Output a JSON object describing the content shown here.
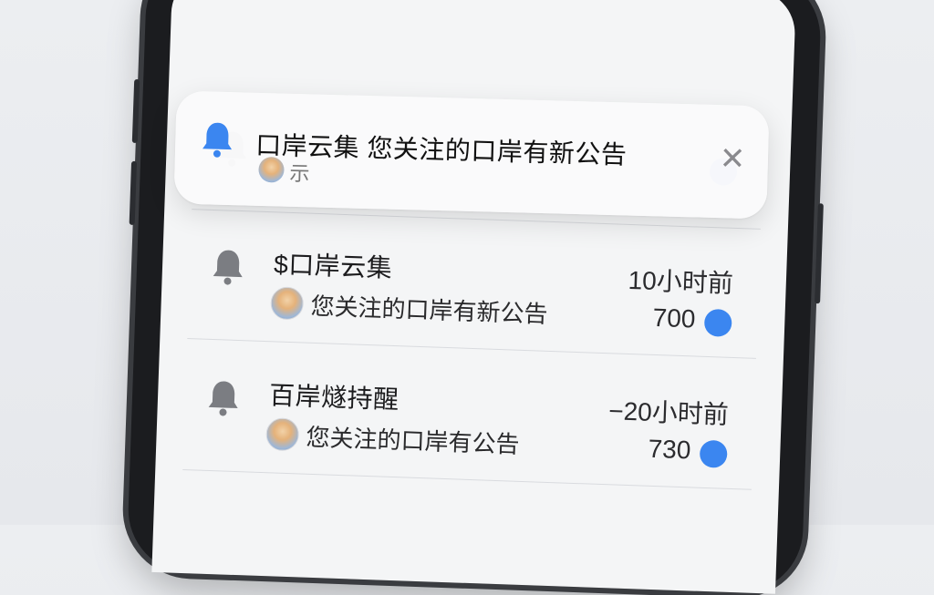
{
  "banner": {
    "title": "口岸云集 您关注的口岸有新公告",
    "subtitle": "示",
    "icon": "bell-icon",
    "close_icon": "close-icon",
    "accent": "#3b86f0"
  },
  "notifications": [
    {
      "title": "$口岸云集",
      "subtitle": "您关注的口岸有新公告",
      "time": "10小时前",
      "count": "700",
      "icon": "bell-icon",
      "unread_color": "#3b86f0"
    },
    {
      "title": "百岸燧持醒",
      "subtitle": "您关注的口岸有公告",
      "time": "−20小时前",
      "count": "730",
      "icon": "bell-icon",
      "unread_color": "#3b86f0"
    }
  ]
}
